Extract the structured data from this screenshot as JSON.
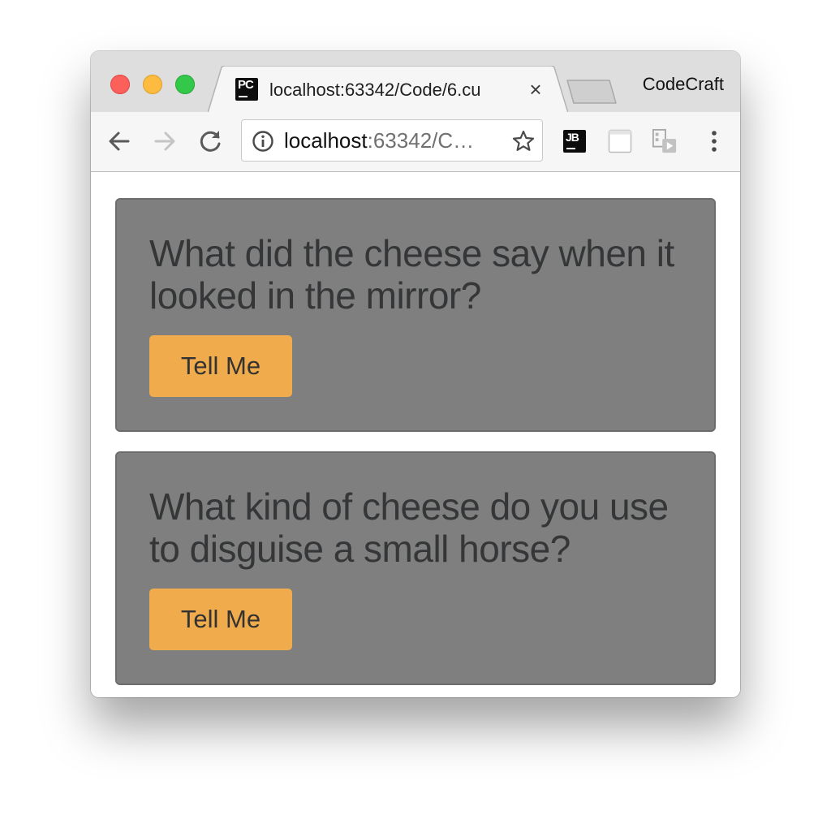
{
  "browser": {
    "tab": {
      "favicon_text": "PC",
      "title": "localhost:63342/Code/6.cu",
      "close_glyph": "×"
    },
    "profile_name": "CodeCraft",
    "address_bar": {
      "host": "localhost",
      "rest": ":63342/C…"
    },
    "extensions": {
      "jetbrains_label": "JB"
    },
    "icons": [
      "back-arrow-icon",
      "forward-arrow-icon",
      "reload-icon",
      "info-icon",
      "star-icon",
      "jetbrains-icon",
      "blank-page-icon",
      "cast-media-icon",
      "kebab-menu-icon"
    ]
  },
  "jokes": [
    {
      "question": "What did the cheese say when it looked in the mirror?",
      "button_label": "Tell Me"
    },
    {
      "question": "What kind of cheese do you use to disguise a small horse?",
      "button_label": "Tell Me"
    }
  ],
  "colors": {
    "card_background": "#7f7f7f",
    "button_background": "#f0ac4c",
    "text": "#343638"
  }
}
